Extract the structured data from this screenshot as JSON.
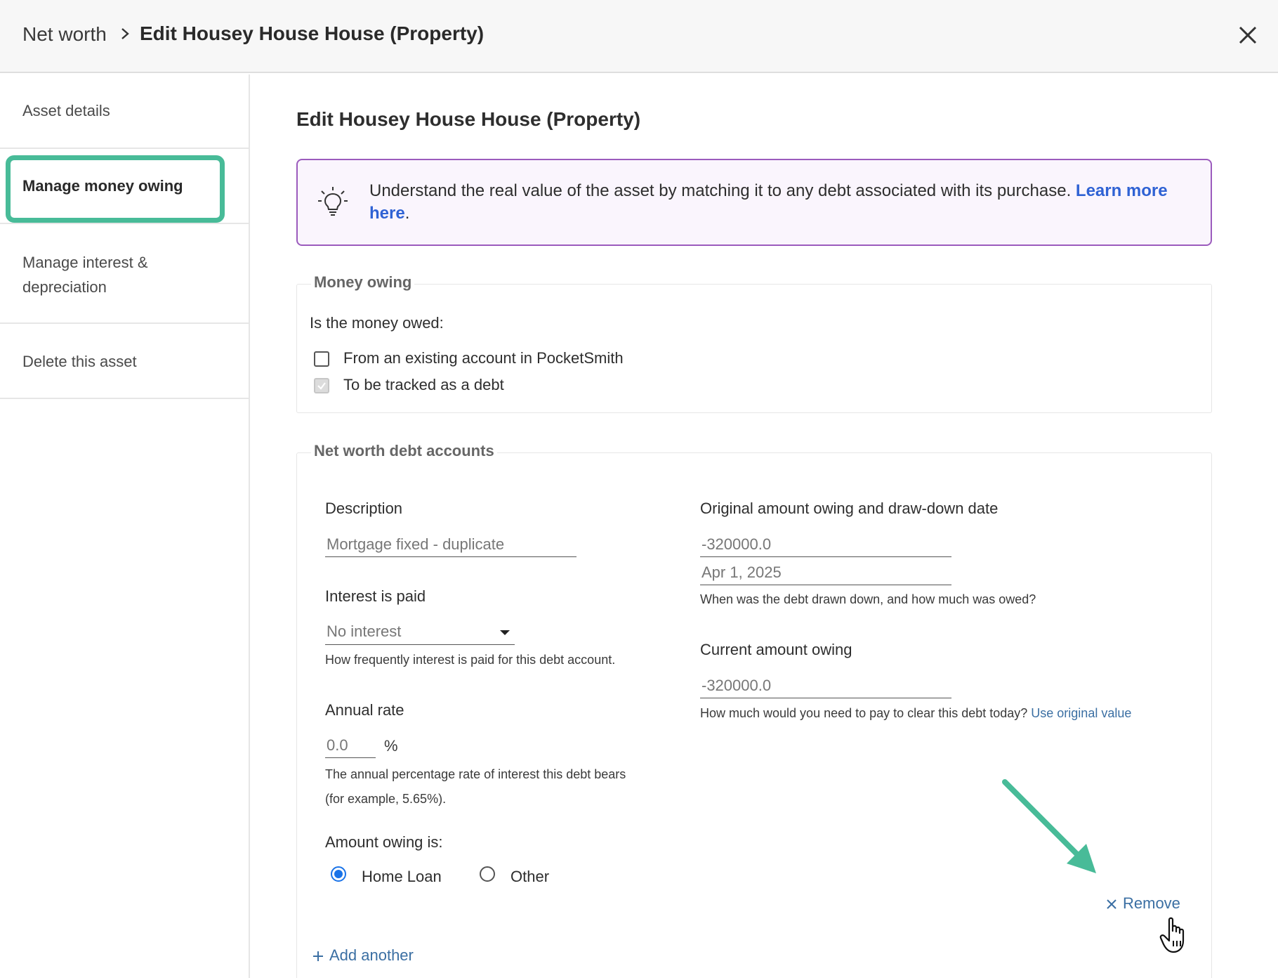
{
  "header": {
    "breadcrumb_root": "Net worth",
    "breadcrumb_current": "Edit Housey House House (Property)"
  },
  "sidebar": {
    "items": [
      {
        "label": "Asset details"
      },
      {
        "label": "Manage money owing"
      },
      {
        "label": "Manage interest & depreciation"
      },
      {
        "label": "Delete this asset"
      }
    ]
  },
  "main": {
    "title": "Edit Housey House House (Property)",
    "info": {
      "text": "Understand the real value of the asset by matching it to any debt associated with its purchase. ",
      "link": "Learn more here",
      "suffix": "."
    },
    "money_owing": {
      "legend": "Money owing",
      "question": "Is the money owed:",
      "options": [
        {
          "label": "From an existing account in PocketSmith",
          "checked": false
        },
        {
          "label": "To be tracked as a debt",
          "checked": true
        }
      ]
    },
    "debt_accounts": {
      "legend": "Net worth debt accounts",
      "description_label": "Description",
      "description_value": "Mortgage fixed - duplicate",
      "interest_label": "Interest is paid",
      "interest_value": "No interest",
      "interest_hint": "How frequently interest is paid for this debt account.",
      "rate_label": "Annual rate",
      "rate_value": "0.0",
      "rate_unit": "%",
      "rate_hint_1": "The annual percentage rate of interest this debt bears",
      "rate_hint_2": "(for example, 5.65%).",
      "amount_type_label": "Amount owing is:",
      "amount_type_options": [
        {
          "label": "Home Loan",
          "checked": true
        },
        {
          "label": "Other",
          "checked": false
        }
      ],
      "original_label": "Original amount owing and draw-down date",
      "original_amount": "-320000.0",
      "original_date": "Apr 1, 2025",
      "original_hint": "When was the debt drawn down, and how much was owed?",
      "current_label": "Current amount owing",
      "current_amount": "-320000.0",
      "current_hint": "How much would you need to pay to clear this debt today? ",
      "current_link": "Use original value",
      "remove_label": "Remove",
      "add_label": "Add another"
    }
  },
  "colors": {
    "accent_teal": "#48bb98",
    "link_blue": "#3b6fa3",
    "info_border": "#9b5bbd",
    "radio_blue": "#1a73e8"
  }
}
